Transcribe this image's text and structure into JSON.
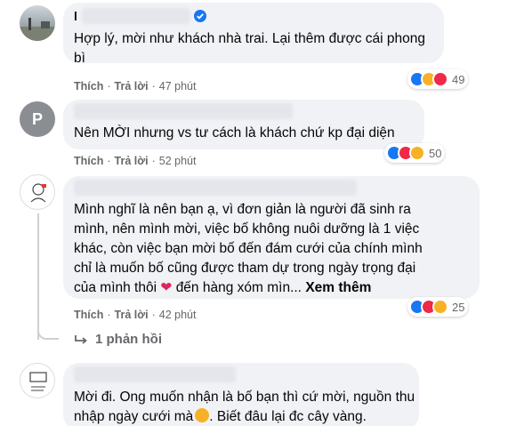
{
  "comments": [
    {
      "name_initial": "l",
      "text_lines": [
        "Hợp lý, mời như khách nhà trai. Lại thêm được cái phong",
        "bì"
      ],
      "actions": {
        "like": "Thích",
        "reply": "Trả lời",
        "time": "47 phút"
      },
      "reaction_count": "49",
      "reaction_icons": [
        "like-icon",
        "haha-icon",
        "love-icon"
      ]
    },
    {
      "avatar_letter": "P",
      "text_lines": [
        "Nên MỜI nhưng vs tư cách là khách chứ kp đại diện"
      ],
      "actions": {
        "like": "Thích",
        "reply": "Trả lời",
        "time": "52 phút"
      },
      "reaction_count": "50",
      "reaction_icons": [
        "like-icon",
        "love-icon",
        "care-icon"
      ]
    },
    {
      "text_lines": [
        "Mình nghĩ là nên bạn ạ, vì đơn giản là người đã sinh ra",
        "mình, nên mình mời, việc bố không nuôi dưỡng là 1 việc",
        "khác, còn việc bạn mời bố đến đám cưới của chính mình",
        "chỉ là muốn bố cũng được tham dự trong ngày trọng đại"
      ],
      "last_line": "của mình thôi",
      "last_line_tail": "đến hàng xóm mìn...",
      "see_more": "Xem thêm",
      "actions": {
        "like": "Thích",
        "reply": "Trả lời",
        "time": "42 phút"
      },
      "reaction_count": "25",
      "reaction_icons": [
        "like-icon",
        "love-icon",
        "care-icon"
      ],
      "replies_label": "1 phản hồi"
    },
    {
      "text_lines": [
        "Mời đi. Ong muốn nhận là bố bạn thì cứ mời, nguồn thu"
      ],
      "last_line": "nhập ngày cưới mà",
      "last_line_tail": ". Biết đâu lại đc cây vàng."
    }
  ],
  "colors": {
    "like": "#1877f2",
    "love": "#f02849",
    "haha": "#f7b125",
    "bubble": "#f0f2f5",
    "verified": "#1877f2"
  }
}
